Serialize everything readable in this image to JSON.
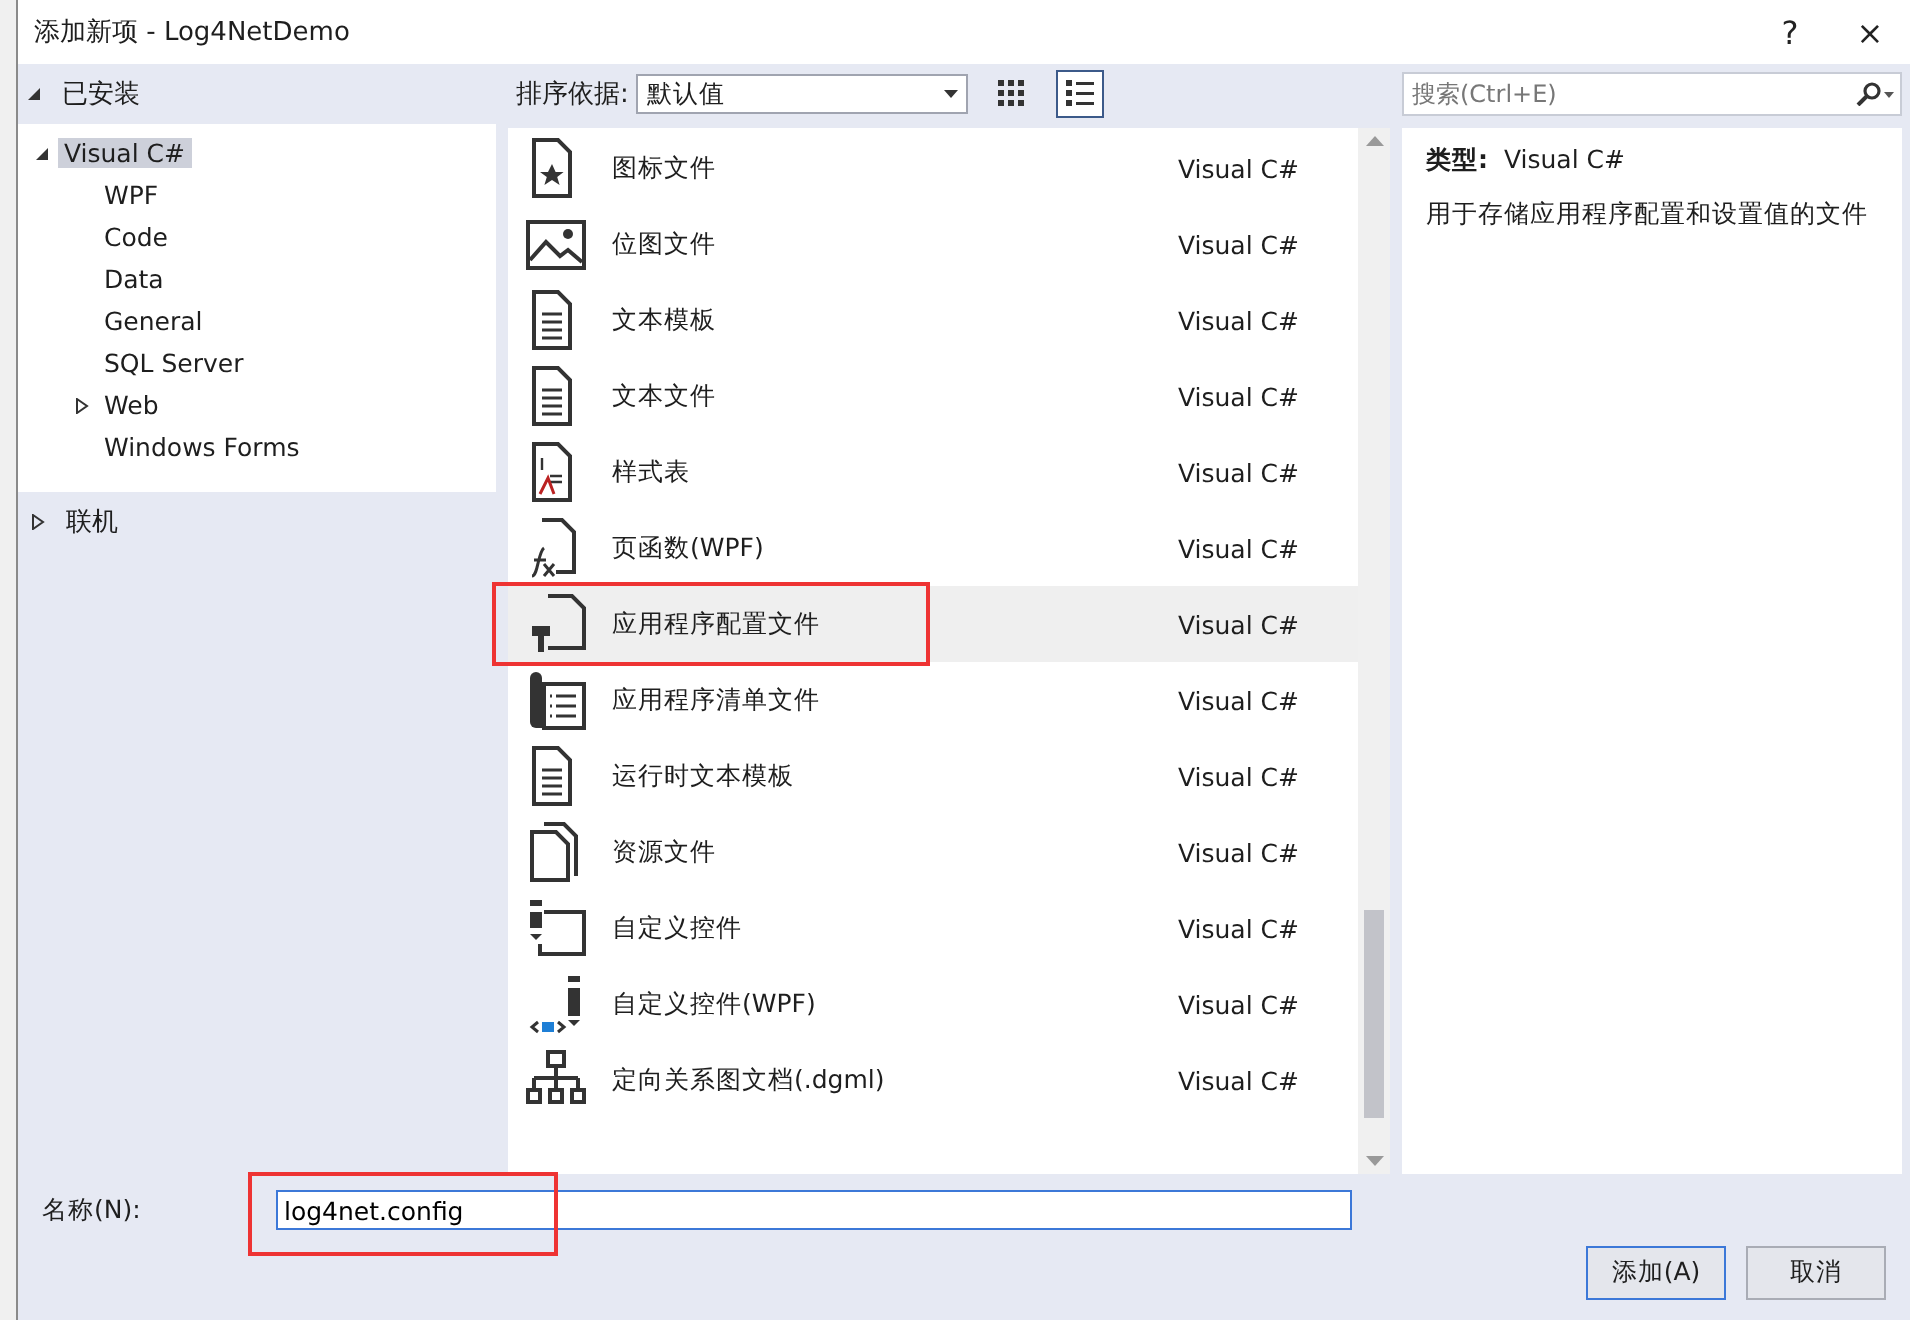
{
  "window": {
    "title": "添加新项 - Log4NetDemo",
    "help_button": "?",
    "close_button": "×"
  },
  "sidebar": {
    "installed": {
      "label": "已安装",
      "expanded": true
    },
    "tree": [
      {
        "label": "Visual C#",
        "expanded": true,
        "selected": true,
        "children": [
          {
            "label": "WPF",
            "selected": false
          },
          {
            "label": "Code",
            "selected": false
          },
          {
            "label": "Data",
            "selected": false
          },
          {
            "label": "General",
            "selected": false
          },
          {
            "label": "SQL Server",
            "selected": false
          },
          {
            "label": "Web",
            "selected": false,
            "expanded": false
          },
          {
            "label": "Windows Forms",
            "selected": false
          }
        ]
      }
    ],
    "online": {
      "label": "联机",
      "expanded": false
    }
  },
  "toolbar": {
    "sort_label": "排序依据:",
    "sort_value": "默认值",
    "grid_view_selected": false,
    "list_view_selected": true
  },
  "search": {
    "placeholder": "搜索(Ctrl+E)"
  },
  "items": [
    {
      "kind": "iconfile",
      "name": "图标文件",
      "type": "Visual C#",
      "selected": false,
      "outlined": false
    },
    {
      "kind": "bitmap",
      "name": "位图文件",
      "type": "Visual C#",
      "selected": false,
      "outlined": false
    },
    {
      "kind": "text",
      "name": "文本模板",
      "type": "Visual C#",
      "selected": false,
      "outlined": false
    },
    {
      "kind": "text",
      "name": "文本文件",
      "type": "Visual C#",
      "selected": false,
      "outlined": false
    },
    {
      "kind": "stylesheet",
      "name": "样式表",
      "type": "Visual C#",
      "selected": false,
      "outlined": false
    },
    {
      "kind": "function",
      "name": "页函数(WPF)",
      "type": "Visual C#",
      "selected": false,
      "outlined": false
    },
    {
      "kind": "config",
      "name": "应用程序配置文件",
      "type": "Visual C#",
      "selected": true,
      "outlined": true
    },
    {
      "kind": "manifest",
      "name": "应用程序清单文件",
      "type": "Visual C#",
      "selected": false,
      "outlined": false
    },
    {
      "kind": "text",
      "name": "运行时文本模板",
      "type": "Visual C#",
      "selected": false,
      "outlined": false
    },
    {
      "kind": "resource",
      "name": "资源文件",
      "type": "Visual C#",
      "selected": false,
      "outlined": false
    },
    {
      "kind": "control",
      "name": "自定义控件",
      "type": "Visual C#",
      "selected": false,
      "outlined": false
    },
    {
      "kind": "wpfcontrol",
      "name": "自定义控件(WPF)",
      "type": "Visual C#",
      "selected": false,
      "outlined": false
    },
    {
      "kind": "diagram",
      "name": "定向关系图文档(.dgml)",
      "type": "Visual C#",
      "selected": false,
      "outlined": false
    }
  ],
  "details": {
    "type_label": "类型:",
    "type_value": "Visual C#",
    "description": "用于存储应用程序配置和设置值的文件"
  },
  "name_field": {
    "label": "名称(N):",
    "value": "log4net.config",
    "outlined": true
  },
  "buttons": [
    {
      "label": "添加(A)",
      "default": true
    },
    {
      "label": "取消",
      "default": false
    }
  ]
}
